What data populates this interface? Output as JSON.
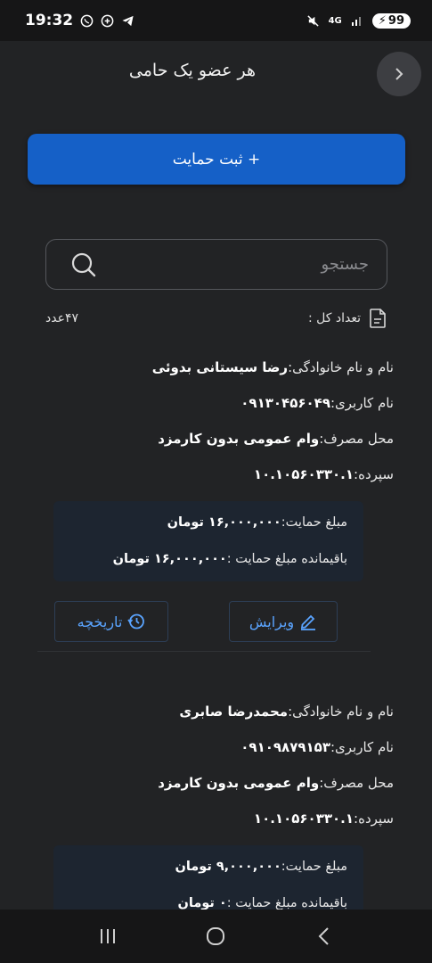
{
  "status_bar": {
    "time": "19:32",
    "battery": "99",
    "network": "4G"
  },
  "header": {
    "title": "هر عضو یک حامی",
    "back_icon": "chevron-right-icon"
  },
  "add_button": {
    "label": "+ ثبت حمایت"
  },
  "search": {
    "placeholder": "جستجو"
  },
  "count": {
    "label": "تعداد کل :",
    "value": "۴۷عدد"
  },
  "cards": [
    {
      "name_label": "نام و نام خانوادگی:",
      "name_value": "رضا سیستانی بدوئی",
      "user_label": "نام کاربری:",
      "user_value": "۰۹۱۳۰۴۵۶۰۴۹",
      "use_label": "محل مصرف:",
      "use_value": "وام عمومی بدون کارمزد",
      "deposit_label": "سپرده:",
      "deposit_value": "۱۰.۱۰۵۶۰۳۳۰.۱",
      "amount_label": "مبلغ حمایت:",
      "amount_value": "۱۶,۰۰۰,۰۰۰ تومان",
      "remain_label": "باقیمانده مبلغ حمایت :",
      "remain_value": "۱۶,۰۰۰,۰۰۰ تومان",
      "edit_label": "ویرایش",
      "history_label": "تاریخچه"
    },
    {
      "name_label": "نام و نام خانوادگی:",
      "name_value": "محمدرضا صابری",
      "user_label": "نام کاربری:",
      "user_value": "۰۹۱۰۹۸۷۹۱۵۳",
      "use_label": "محل مصرف:",
      "use_value": "وام عمومی بدون کارمزد",
      "deposit_label": "سپرده:",
      "deposit_value": "۱۰.۱۰۵۶۰۳۳۰.۱",
      "amount_label": "مبلغ حمایت:",
      "amount_value": "۹,۰۰۰,۰۰۰ تومان",
      "remain_label": "باقیمانده مبلغ حمایت :",
      "remain_value": "۰ تومان"
    }
  ],
  "colors": {
    "background": "#222325",
    "primary": "#1560c7",
    "accent_text": "#5aa4ff",
    "amount_box": "#1d2530"
  }
}
